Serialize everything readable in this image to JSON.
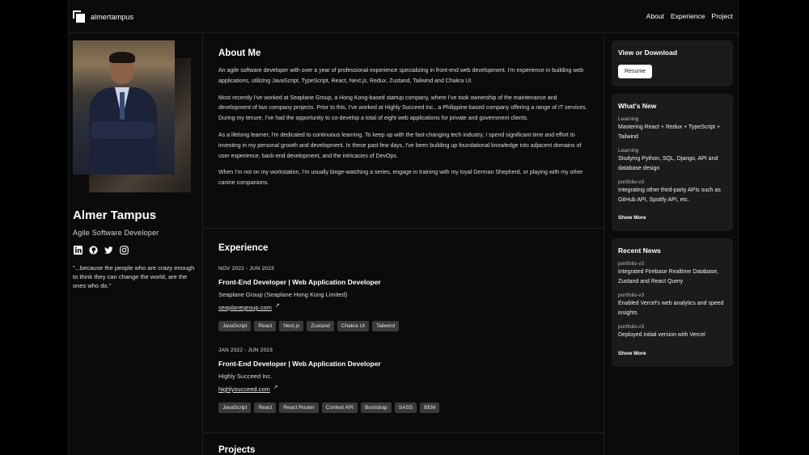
{
  "header": {
    "logo_text": "almertampus",
    "nav": [
      "About",
      "Experience",
      "Project"
    ]
  },
  "profile": {
    "name": "Almer Tampus",
    "role": "Agile Software Developer",
    "socials": [
      "linkedin-icon",
      "github-icon",
      "twitter-icon",
      "instagram-icon"
    ],
    "quote": "\"...because the people who are crazy enough to think they can change the world, are the ones who do.\""
  },
  "about": {
    "title": "About Me",
    "paragraphs": [
      "An agile software developer with over a year of professional experience specializing in front-end web development. I'm experience in building web applications, utilizing JavaScript, TypeScript, React, Next.js, Redux, Zustand, Tailwind and Chakra UI.",
      "Most recently I've worked at Seaplane Group, a Hong Kong-based startup company, where I've took ownership of the maintenance and development of two company projects. Prior to this, I've worked at Highly Succeed Inc., a Philippine-based company offering a range of IT services. During my tenure, I've had the opportunity to co-develop a total of eight web applications for private and government clients.",
      "As a lifelong learner, I'm dedicated to continuous learning. To keep up with the fast-changing tech industry, I spend significant time and effort to investing in my personal growth and development. In these past few days, I've been building up foundational knowledge into adjacent domains of user experience, back-end development, and the intricacies of DevOps.",
      "When I'm not on my workstation, I'm usually binge-watching a series, engage in training with my loyal German Shepherd, or playing with my other canine companions."
    ]
  },
  "experience": {
    "title": "Experience",
    "items": [
      {
        "date": "NOV 2022 - JUN 2023",
        "title": "Front-End Developer | Web Application Developer",
        "company": "Seaplane Group (Seaplane Hong Kong Limited)",
        "link": "seaplanegroup.com",
        "tags": [
          "JavaScript",
          "React",
          "Next.js",
          "Zustand",
          "Chakra UI",
          "Tailwind"
        ]
      },
      {
        "date": "JAN 2022 - JUN 2023",
        "title": "Front-End Developer | Web Application Developer",
        "company": "Highly Succeed Inc.",
        "link": "highlysucceed.com",
        "tags": [
          "JavaScript",
          "React",
          "React Router",
          "Context API",
          "Bootstrap",
          "SASS",
          "BEM"
        ]
      }
    ]
  },
  "projects": {
    "title": "Projects"
  },
  "sidebar": {
    "download": {
      "title": "View or Download",
      "button": "Resume"
    },
    "whats_new": {
      "title": "What's New",
      "items": [
        {
          "tag": "Learning",
          "text": "Mastering React + Redux + TypeScript + Tailwind"
        },
        {
          "tag": "Learning",
          "text": "Studying Python, SQL, Django, API and database design"
        },
        {
          "tag": "portfolio-v3",
          "text": "Integrating other third-party APIs such as GitHub API, Spotify API, etc."
        }
      ],
      "show_more": "Show More"
    },
    "recent_news": {
      "title": "Recent News",
      "items": [
        {
          "tag": "portfolio-v3",
          "text": "Integrated Firebase Realtime Database, Zustand and React Query"
        },
        {
          "tag": "portfolio-v3",
          "text": "Enabled Vercel's web analytics and speed insights"
        },
        {
          "tag": "portfolio-v3",
          "text": "Deployed initial version with Vercel"
        }
      ],
      "show_more": "Show More"
    }
  }
}
